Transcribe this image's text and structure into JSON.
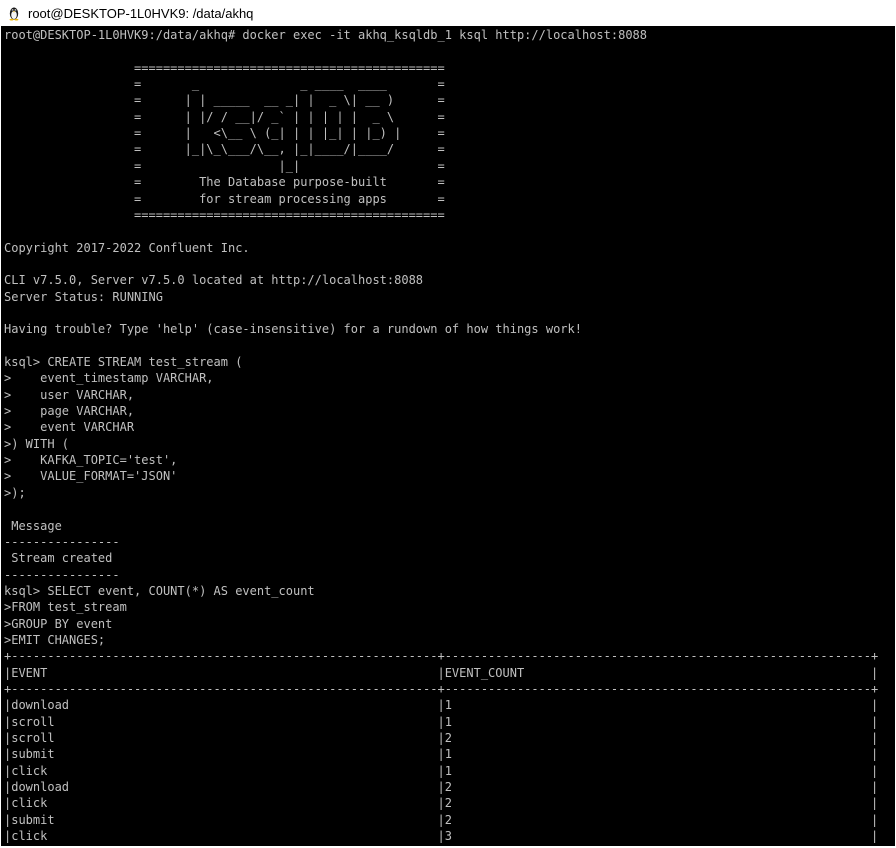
{
  "window": {
    "title": "root@DESKTOP-1L0HVK9: /data/akhq",
    "icon": "linux-tux-icon"
  },
  "terminal": {
    "background": "#000000",
    "foreground": "#c0c0c0",
    "lines": [
      "root@DESKTOP-1L0HVK9:/data/akhq# docker exec -it akhq_ksqldb_1 ksql http://localhost:8088",
      "",
      "                  ===========================================",
      "                  =       _              _ ____  ____       =",
      "                  =      | | _____  __ _| |  _ \\| __ )      =",
      "                  =      | |/ / __|/ _` | | | | |  _ \\      =",
      "                  =      |   <\\__ \\ (_| | | |_| | |_) |     =",
      "                  =      |_|\\_\\___/\\__, |_|____/|____/      =",
      "                  =                   |_|                   =",
      "                  =        The Database purpose-built       =",
      "                  =        for stream processing apps       =",
      "                  ===========================================",
      "",
      "Copyright 2017-2022 Confluent Inc.",
      "",
      "CLI v7.5.0, Server v7.5.0 located at http://localhost:8088",
      "Server Status: RUNNING",
      "",
      "Having trouble? Type 'help' (case-insensitive) for a rundown of how things work!",
      "",
      "ksql> CREATE STREAM test_stream (",
      ">    event_timestamp VARCHAR,",
      ">    user VARCHAR,",
      ">    page VARCHAR,",
      ">    event VARCHAR",
      ">) WITH (",
      ">    KAFKA_TOPIC='test',",
      ">    VALUE_FORMAT='JSON'",
      ">);",
      "",
      " Message",
      "----------------",
      " Stream created",
      "----------------",
      "ksql> SELECT event, COUNT(*) AS event_count",
      ">FROM test_stream",
      ">GROUP BY event",
      ">EMIT CHANGES;",
      "+-----------------------------------------------------------+-----------------------------------------------------------+",
      "|EVENT                                                      |EVENT_COUNT                                                |",
      "+-----------------------------------------------------------+-----------------------------------------------------------+",
      "|download                                                   |1                                                          |",
      "|scroll                                                     |1                                                          |",
      "|scroll                                                     |2                                                          |",
      "|submit                                                     |1                                                          |",
      "|click                                                      |1                                                          |",
      "|download                                                   |2                                                          |",
      "|click                                                      |2                                                          |",
      "|submit                                                     |2                                                          |",
      "|click                                                      |3                                                          |"
    ]
  }
}
